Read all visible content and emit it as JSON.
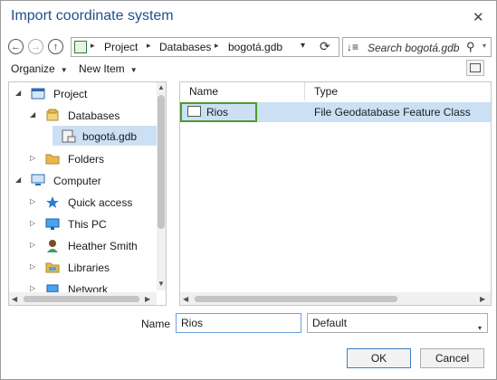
{
  "window": {
    "title": "Import coordinate system",
    "close_glyph": "✕"
  },
  "nav": {
    "back_glyph": "←",
    "forward_glyph": "→",
    "up_glyph": "↑",
    "breadcrumb": [
      "Project",
      "Databases",
      "bogotá.gdb"
    ],
    "separator_glyph": "▸",
    "refresh_glyph": "⟳",
    "search_sort_glyph": "↓≡",
    "search_placeholder": "Search bogotá.gdb",
    "search_glyph": "⚲",
    "dropdown_glyph": "▾"
  },
  "toolbar": {
    "organize_label": "Organize",
    "new_item_label": "New Item",
    "caret_glyph": "▼"
  },
  "tree": {
    "expanded_glyph": "◢",
    "collapsed_glyph": "▷",
    "items": [
      {
        "label": "Project",
        "icon": "project-icon"
      },
      {
        "label": "Databases",
        "icon": "databases-icon"
      },
      {
        "label": "bogotá.gdb",
        "icon": "geodatabase-icon",
        "selected": true
      },
      {
        "label": "Folders",
        "icon": "folder-icon"
      },
      {
        "label": "Computer",
        "icon": "computer-icon"
      },
      {
        "label": "Quick access",
        "icon": "star-icon"
      },
      {
        "label": "This PC",
        "icon": "monitor-icon"
      },
      {
        "label": "Heather Smith",
        "icon": "user-icon"
      },
      {
        "label": "Libraries",
        "icon": "libraries-icon"
      },
      {
        "label": "Network",
        "icon": "network-icon"
      }
    ]
  },
  "scroll_glyphs": {
    "up": "▲",
    "down": "▼",
    "left": "◀",
    "right": "▶"
  },
  "files": {
    "columns": [
      "Name",
      "Type"
    ],
    "rows": [
      {
        "name": "Rios",
        "type": "File Geodatabase Feature Class",
        "icon": "feature-class-icon",
        "selected": true
      }
    ]
  },
  "footer": {
    "name_label": "Name",
    "name_value": "Rios",
    "type_value": "Default",
    "ok_label": "OK",
    "cancel_label": "Cancel"
  },
  "colors": {
    "title": "#1f4f8f",
    "selection": "#cce0f5",
    "highlight_border": "#4c9a2a",
    "folder": "#e8b84b"
  }
}
